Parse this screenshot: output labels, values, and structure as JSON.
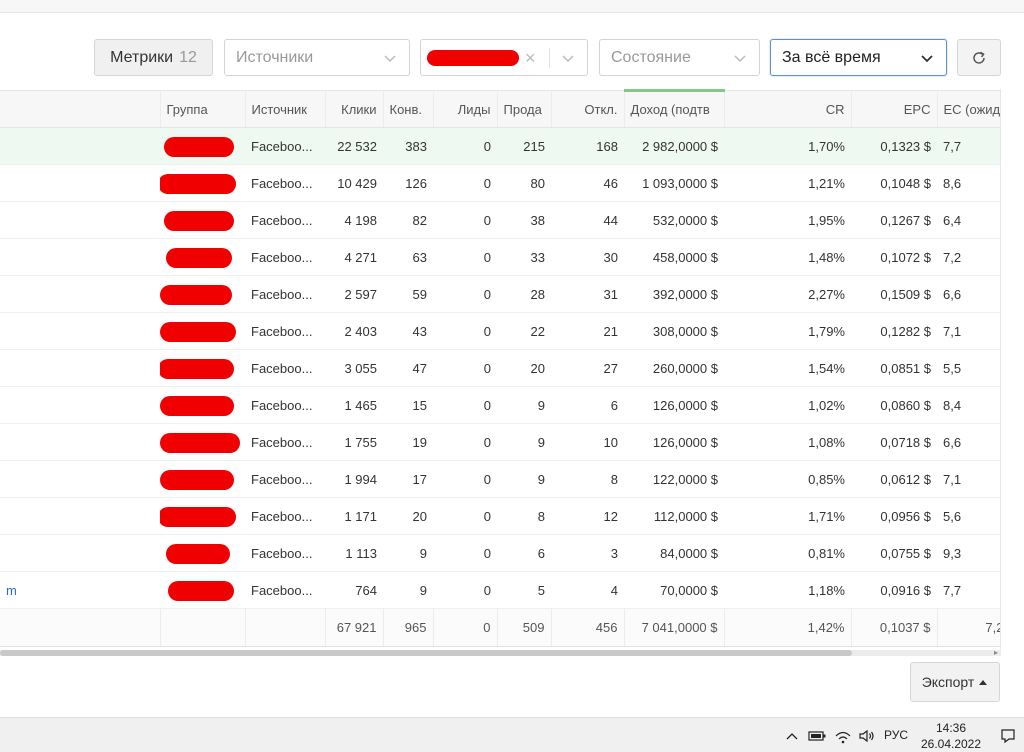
{
  "toolbar": {
    "metrics_label": "Метрики",
    "metrics_count": "12",
    "sources_placeholder": "Источники",
    "state_placeholder": "Состояние",
    "period_value": "За всё время",
    "clear_symbol": "×",
    "export_label": "Экспорт"
  },
  "table": {
    "headers": {
      "group": "Группа",
      "source": "Источник",
      "clicks": "Клики",
      "conv": "Конв.",
      "leads": "Лиды",
      "sales": "Прода",
      "rejects": "Откл.",
      "income": "Доход (подтв",
      "cr": "CR",
      "epc": "EPC",
      "ec": "EC (ожид"
    },
    "rows": [
      {
        "lead": "",
        "source": "Faceboo...",
        "clicks": "22 532",
        "conv": "383",
        "leads": "0",
        "sales": "215",
        "rejects": "168",
        "income": "2 982,0000 $",
        "cr": "1,70%",
        "epc": "0,1323 $",
        "ec": "7,7"
      },
      {
        "lead": "",
        "source": "Faceboo...",
        "clicks": "10 429",
        "conv": "126",
        "leads": "0",
        "sales": "80",
        "rejects": "46",
        "income": "1 093,0000 $",
        "cr": "1,21%",
        "epc": "0,1048 $",
        "ec": "8,6"
      },
      {
        "lead": "",
        "source": "Faceboo...",
        "clicks": "4 198",
        "conv": "82",
        "leads": "0",
        "sales": "38",
        "rejects": "44",
        "income": "532,0000 $",
        "cr": "1,95%",
        "epc": "0,1267 $",
        "ec": "6,4"
      },
      {
        "lead": "",
        "source": "Faceboo...",
        "clicks": "4 271",
        "conv": "63",
        "leads": "0",
        "sales": "33",
        "rejects": "30",
        "income": "458,0000 $",
        "cr": "1,48%",
        "epc": "0,1072 $",
        "ec": "7,2"
      },
      {
        "lead": "",
        "source": "Faceboo...",
        "clicks": "2 597",
        "conv": "59",
        "leads": "0",
        "sales": "28",
        "rejects": "31",
        "income": "392,0000 $",
        "cr": "2,27%",
        "epc": "0,1509 $",
        "ec": "6,6"
      },
      {
        "lead": "",
        "source": "Faceboo...",
        "clicks": "2 403",
        "conv": "43",
        "leads": "0",
        "sales": "22",
        "rejects": "21",
        "income": "308,0000 $",
        "cr": "1,79%",
        "epc": "0,1282 $",
        "ec": "7,1"
      },
      {
        "lead": "",
        "source": "Faceboo...",
        "clicks": "3 055",
        "conv": "47",
        "leads": "0",
        "sales": "20",
        "rejects": "27",
        "income": "260,0000 $",
        "cr": "1,54%",
        "epc": "0,0851 $",
        "ec": "5,5"
      },
      {
        "lead": "",
        "source": "Faceboo...",
        "clicks": "1 465",
        "conv": "15",
        "leads": "0",
        "sales": "9",
        "rejects": "6",
        "income": "126,0000 $",
        "cr": "1,02%",
        "epc": "0,0860 $",
        "ec": "8,4"
      },
      {
        "lead": "",
        "source": "Faceboo...",
        "clicks": "1 755",
        "conv": "19",
        "leads": "0",
        "sales": "9",
        "rejects": "10",
        "income": "126,0000 $",
        "cr": "1,08%",
        "epc": "0,0718 $",
        "ec": "6,6"
      },
      {
        "lead": "",
        "source": "Faceboo...",
        "clicks": "1 994",
        "conv": "17",
        "leads": "0",
        "sales": "9",
        "rejects": "8",
        "income": "122,0000 $",
        "cr": "0,85%",
        "epc": "0,0612 $",
        "ec": "7,1"
      },
      {
        "lead": "",
        "source": "Faceboo...",
        "clicks": "1 171",
        "conv": "20",
        "leads": "0",
        "sales": "8",
        "rejects": "12",
        "income": "112,0000 $",
        "cr": "1,71%",
        "epc": "0,0956 $",
        "ec": "5,6"
      },
      {
        "lead": "",
        "source": "Faceboo...",
        "clicks": "1 113",
        "conv": "9",
        "leads": "0",
        "sales": "6",
        "rejects": "3",
        "income": "84,0000 $",
        "cr": "0,81%",
        "epc": "0,0755 $",
        "ec": "9,3"
      },
      {
        "lead": "m",
        "source": "Faceboo...",
        "clicks": "764",
        "conv": "9",
        "leads": "0",
        "sales": "5",
        "rejects": "4",
        "income": "70,0000 $",
        "cr": "1,18%",
        "epc": "0,0916 $",
        "ec": "7,7"
      }
    ],
    "totals": {
      "clicks": "67 921",
      "conv": "965",
      "leads": "0",
      "sales": "509",
      "rejects": "456",
      "income": "7 041,0000 $",
      "cr": "1,42%",
      "epc": "0,1037 $",
      "ec": "7,2"
    }
  },
  "taskbar": {
    "lang": "РУС",
    "time": "14:36",
    "date": "26.04.2022"
  },
  "colors": {
    "accent": "#5b8fd6",
    "redaction": "#f00000",
    "active_row": "#eef9f2",
    "income_header_bar": "#84c889",
    "link": "#2a6fc7"
  }
}
